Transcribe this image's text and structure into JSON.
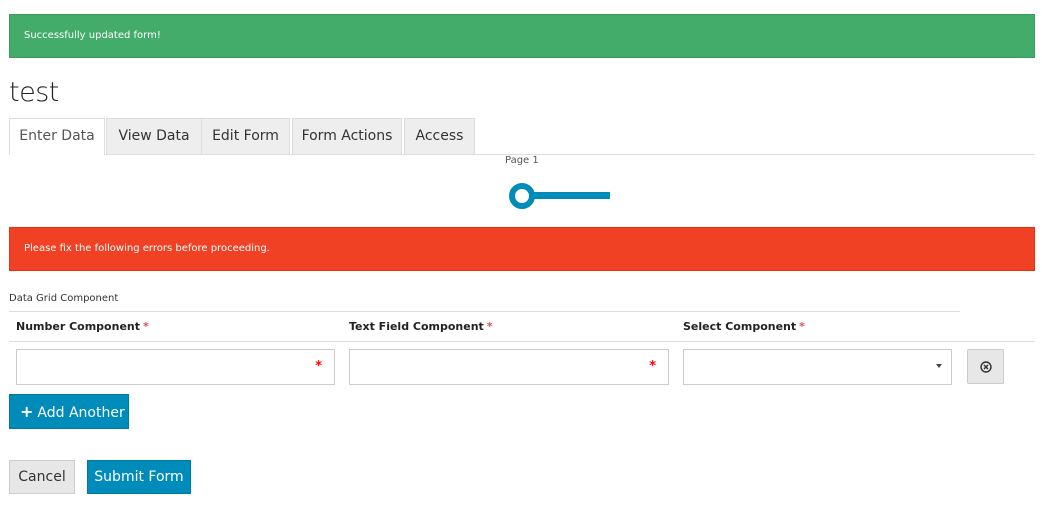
{
  "alerts": {
    "success": "Successfully updated form!",
    "error": "Please fix the following errors before proceeding."
  },
  "form": {
    "title": "test"
  },
  "tabs": [
    {
      "label": "Enter Data",
      "active": true
    },
    {
      "label": "View Data",
      "active": false
    },
    {
      "label": "Edit Form",
      "active": false
    },
    {
      "label": "Form Actions",
      "active": false
    },
    {
      "label": "Access",
      "active": false
    }
  ],
  "wizard": {
    "page_label": "Page 1",
    "accent_color": "#008cba"
  },
  "data_grid": {
    "label": "Data Grid Component",
    "columns": [
      {
        "label": "Number Component",
        "required": "*"
      },
      {
        "label": "Text Field Component",
        "required": "*"
      },
      {
        "label": "Select Component",
        "required": "*"
      }
    ],
    "row": {
      "number_value": "",
      "text_value": "",
      "select_value": "",
      "required_marker": "*"
    },
    "remove_icon": "remove-circle-icon",
    "add_label": "Add Another"
  },
  "buttons": {
    "cancel": "Cancel",
    "submit": "Submit Form"
  },
  "colors": {
    "success": "#43ac6a",
    "danger": "#f04124",
    "primary": "#008cba"
  }
}
